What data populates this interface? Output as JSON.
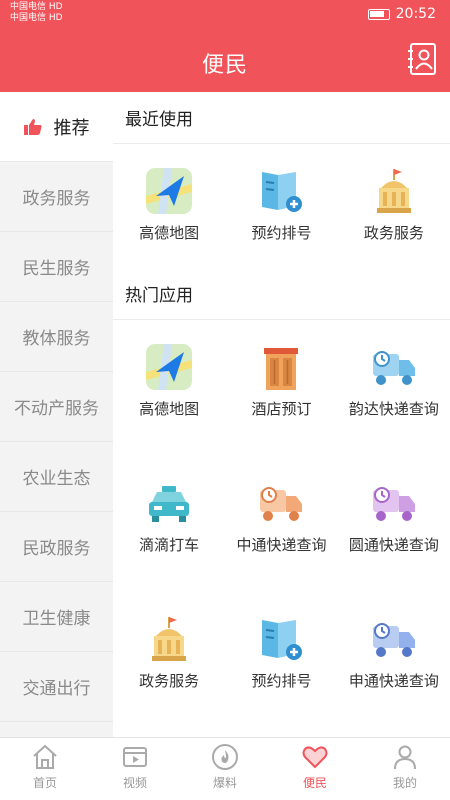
{
  "status_bar": {
    "carrier_1": "中国电信 HD",
    "carrier_2": "中国电信 HD",
    "time": "20:52"
  },
  "header": {
    "title": "便民"
  },
  "sidebar": {
    "items": [
      {
        "label": "推荐",
        "active": true
      },
      {
        "label": "政务服务"
      },
      {
        "label": "民生服务"
      },
      {
        "label": "教体服务"
      },
      {
        "label": "不动产服务"
      },
      {
        "label": "农业生态"
      },
      {
        "label": "民政服务"
      },
      {
        "label": "卫生健康"
      },
      {
        "label": "交通出行"
      }
    ]
  },
  "recent": {
    "title": "最近使用",
    "items": [
      {
        "label": "高德地图",
        "icon": "gaode-map-icon"
      },
      {
        "label": "预约排号",
        "icon": "booking-number-icon"
      },
      {
        "label": "政务服务",
        "icon": "government-service-icon"
      }
    ]
  },
  "hot": {
    "title": "热门应用",
    "items": [
      {
        "label": "高德地图",
        "icon": "gaode-map-icon"
      },
      {
        "label": "酒店预订",
        "icon": "hotel-booking-icon"
      },
      {
        "label": "韵达快递查询",
        "icon": "yunda-express-icon"
      },
      {
        "label": "滴滴打车",
        "icon": "didi-taxi-icon"
      },
      {
        "label": "中通快递查询",
        "icon": "zto-express-icon"
      },
      {
        "label": "圆通快递查询",
        "icon": "yto-express-icon"
      },
      {
        "label": "政务服务",
        "icon": "government-service-icon"
      },
      {
        "label": "预约排号",
        "icon": "booking-number-icon"
      },
      {
        "label": "申通快递查询",
        "icon": "sto-express-icon"
      }
    ]
  },
  "tabbar": {
    "items": [
      {
        "label": "首页",
        "icon": "home-icon"
      },
      {
        "label": "视频",
        "icon": "video-icon"
      },
      {
        "label": "爆料",
        "icon": "fire-icon"
      },
      {
        "label": "便民",
        "icon": "heart-icon",
        "active": true
      },
      {
        "label": "我的",
        "icon": "profile-icon"
      }
    ]
  },
  "colors": {
    "accent": "#f0535a",
    "sidebar_bg": "#f3f3f3"
  }
}
